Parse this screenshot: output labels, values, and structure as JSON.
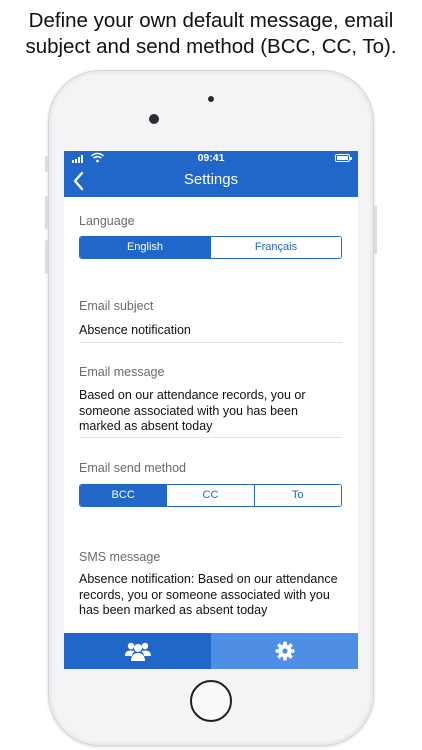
{
  "caption": {
    "line1": "Define your own default message, email",
    "line2": "subject and send method (BCC, CC, To)."
  },
  "status_bar": {
    "time": "09:41"
  },
  "nav": {
    "title": "Settings",
    "back_icon": "chevron-left-icon"
  },
  "language": {
    "label": "Language",
    "options": [
      "English",
      "Français"
    ],
    "selected": "English"
  },
  "email_subject": {
    "label": "Email subject",
    "value": "Absence notification"
  },
  "email_message": {
    "label": "Email message",
    "value": "Based on our attendance records, you or someone associated with you has been marked as absent today"
  },
  "send_method": {
    "label": "Email send method",
    "options": [
      "BCC",
      "CC",
      "To"
    ],
    "selected": "BCC"
  },
  "sms_message": {
    "label": "SMS message",
    "value": "Absence notification: Based on our attendance records, you or someone associated with you has been marked as absent today"
  },
  "tab_bar": {
    "tabs": [
      {
        "icon": "users-icon",
        "active": false
      },
      {
        "icon": "gear-icon",
        "active": true
      }
    ]
  },
  "colors": {
    "accent": "#2166c9",
    "tab_active": "#4f8ee6",
    "label": "#6b6b6b"
  }
}
